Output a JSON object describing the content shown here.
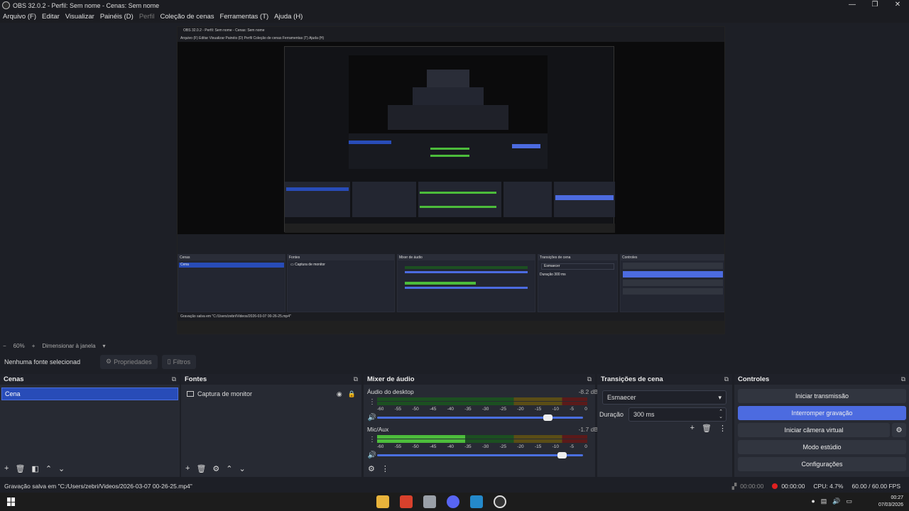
{
  "window": {
    "title": "OBS 32.0.2 - Perfil: Sem nome - Cenas: Sem nome",
    "controls": [
      "—",
      "❐",
      "✕"
    ]
  },
  "menu": {
    "items": [
      {
        "label": "Arquivo (F)",
        "disabled": false
      },
      {
        "label": "Editar",
        "disabled": false
      },
      {
        "label": "Visualizar",
        "disabled": false
      },
      {
        "label": "Painéis (D)",
        "disabled": false
      },
      {
        "label": "Perfil",
        "disabled": true
      },
      {
        "label": "Coleção de cenas",
        "disabled": false
      },
      {
        "label": "Ferramentas (T)",
        "disabled": false
      },
      {
        "label": "Ajuda (H)",
        "disabled": false
      }
    ]
  },
  "preview_nested": {
    "title": "OBS 32.0.2 - Perfil: Sem nome - Cenas: Sem nome",
    "menu": "Arquivo (F)   Editar   Visualizar   Painéis (D)   Perfil   Coleção de cenas   Ferramentas (T)   Ajuda (H)",
    "status": "Gravação salva em \"C:/Users/zebri/Videos/2026-03-07 00-26-25.mp4\""
  },
  "toolbar": {
    "minus": "−",
    "zoom": "60%",
    "plus": "+",
    "resize_label": "Dimensionar à janela",
    "resize_caret": "▾"
  },
  "source_bar": {
    "no_source": "Nenhuma fonte selecionad",
    "properties": "Propriedades",
    "filters": "Filtros"
  },
  "scenes": {
    "title": "Cenas",
    "items": [
      "Cena"
    ]
  },
  "sources": {
    "title": "Fontes",
    "items": [
      {
        "name": "Captura de monitor"
      }
    ]
  },
  "mixer": {
    "title": "Mixer de áudio",
    "scale": [
      "-60",
      "-55",
      "-50",
      "-45",
      "-40",
      "-35",
      "-30",
      "-25",
      "-20",
      "-15",
      "-10",
      "-5",
      "0"
    ],
    "channels": [
      {
        "name": "Áudio do desktop",
        "db": "-8.2 dB",
        "level": 0.0,
        "volume": 0.83
      },
      {
        "name": "Mic/Aux",
        "db": "-1.7 dB",
        "level": 0.42,
        "volume": 0.9
      }
    ]
  },
  "transitions": {
    "title": "Transições de cena",
    "selected": "Esmaecer",
    "duration_label": "Duração",
    "duration_value": "300 ms"
  },
  "controls": {
    "title": "Controles",
    "start_stream": "Iniciar transmissão",
    "stop_record": "Interromper gravação",
    "virtual_cam": "Iniciar câmera virtual",
    "studio_mode": "Modo estúdio",
    "settings": "Configurações"
  },
  "status": {
    "message": "Gravação salva em \"C:/Users/zebri/Videos/2026-03-07 00-26-25.mp4\"",
    "stream_time": "00:00:00",
    "rec_time": "00:00:00",
    "cpu": "CPU: 4.7%",
    "fps": "60.00 / 60.00 FPS"
  },
  "clock": {
    "time": "00:27",
    "date": "07/03/2026"
  },
  "colors": {
    "accent": "#4c6be0",
    "selected": "#284cb8",
    "rec": "#e02020"
  }
}
